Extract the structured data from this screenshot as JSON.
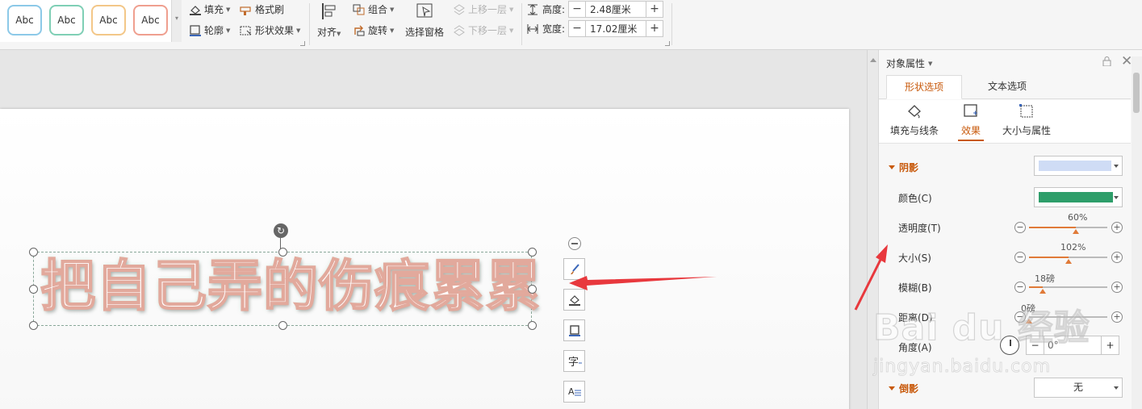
{
  "ribbon": {
    "style_presets": [
      "Abc",
      "Abc",
      "Abc",
      "Abc"
    ],
    "style_preset_colors": [
      "#8cc9e8",
      "#7fcfb5",
      "#f3c788",
      "#ef9f8f"
    ],
    "fill_label": "填充",
    "format_painter_label": "格式刷",
    "outline_label": "轮廓",
    "shape_effects_label": "形状效果",
    "align_label": "对齐",
    "group_label": "组合",
    "rotate_label": "旋转",
    "selection_pane_label": "选择窗格",
    "bring_forward_label": "上移一层",
    "send_backward_label": "下移一层",
    "height_label": "高度:",
    "height_value": "2.48厘米",
    "width_label": "宽度:",
    "width_value": "17.02厘米"
  },
  "slide": {
    "wordart_text": "把自己弄的伤痕累累"
  },
  "panel": {
    "title": "对象属性",
    "tabs": [
      {
        "label": "形状选项",
        "active": true
      },
      {
        "label": "文本选项",
        "active": false
      }
    ],
    "subtabs": [
      {
        "label": "填充与线条",
        "icon": "fill-bucket-icon",
        "active": false
      },
      {
        "label": "效果",
        "icon": "effects-icon",
        "active": true
      },
      {
        "label": "大小与属性",
        "icon": "size-properties-icon",
        "active": false
      }
    ],
    "shadow": {
      "heading": "阴影",
      "preset_color": "#cfdcf5",
      "color_label": "颜色(C)",
      "color_value": "#2e9e6a",
      "transparency_label": "透明度(T)",
      "transparency_value": "60%",
      "transparency_level": 0.6,
      "size_label": "大小(S)",
      "size_value": "102%",
      "size_level": 0.51,
      "blur_label": "模糊(B)",
      "blur_value": "18磅",
      "blur_level": 0.18,
      "distance_label": "距离(D)",
      "distance_value": "0磅",
      "distance_level": 0.0,
      "angle_label": "角度(A)",
      "angle_value": "0°"
    },
    "reflection": {
      "heading": "倒影",
      "value": "无"
    }
  },
  "watermark": {
    "brand": "Bai du 经验",
    "url": "jingyan.baidu.com"
  },
  "colors": {
    "accent": "#c8590b",
    "annotation_arrow": "#e8383d"
  }
}
